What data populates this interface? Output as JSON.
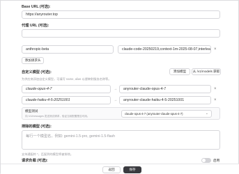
{
  "base_url": {
    "label": "Base URL (可选):",
    "value": "https://anyrouter.top"
  },
  "proxy_url": {
    "label": "代理 URL (可选):",
    "value": ""
  },
  "header": {
    "key": "anthropic-beta",
    "value": "claude-code-20250219,context-1m-2025-08-07,interleav"
  },
  "add_header_label": "添加请求头",
  "custom_models": {
    "label": "自定义模型 (可选):",
    "add_button": "添加模型",
    "fetch_button": "从 /v1/models 获取",
    "hint": "为供应商添加自定义模型，可填写 name, alias 以便映射服务名称等。",
    "rows": [
      {
        "name": "claude-opus-4-7",
        "alias": "anyrouter-claude-opus-4-7"
      },
      {
        "name": "claude-haiku-4-5-20251001",
        "alias": "anyrouter-claude-haiku-4-5-20251001"
      }
    ]
  },
  "test_model": {
    "label": "模型测试",
    "hint": "向 /v1/messages 发送测试请求，验证当前配置是否可用。",
    "selected": "claude-opus-4-7 (anyrouter-claude-opus-4-7)"
  },
  "excluded_models": {
    "label": "排除的模型 (可选):",
    "placeholder": "每行一个模型名，例如: gemini-1.5-pro, gemini-1.5-flash",
    "hint": "支持通配符 *，匹配到的模型将被排除。"
  },
  "request_override": {
    "label": "请求负载 (可选):",
    "hint": "为该供应商覆盖请求负载参数，示例: max_tokens。",
    "toggle_label": "启用"
  },
  "footer": {
    "cancel": "返回",
    "save": "保存"
  }
}
